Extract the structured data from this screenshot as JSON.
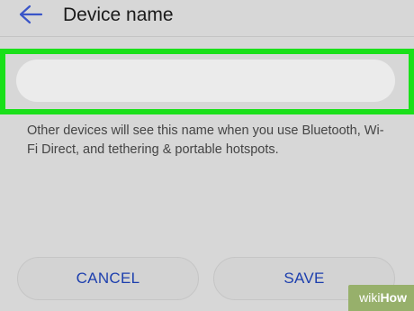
{
  "header": {
    "back_icon": "arrow-left-icon",
    "title": "Device name"
  },
  "name_field": {
    "value": "",
    "placeholder": ""
  },
  "helper_text": "Other devices will see this name when you use Bluetooth, Wi-Fi Direct, and tethering & portable hotspots.",
  "actions": {
    "cancel_label": "CANCEL",
    "save_label": "SAVE"
  },
  "watermark": {
    "part1": "wiki",
    "part2": "How"
  },
  "colors": {
    "background": "#d7d7d7",
    "highlight": "#1ae01a",
    "accent": "#1d3fae",
    "watermark_bg": "#97b06b"
  }
}
